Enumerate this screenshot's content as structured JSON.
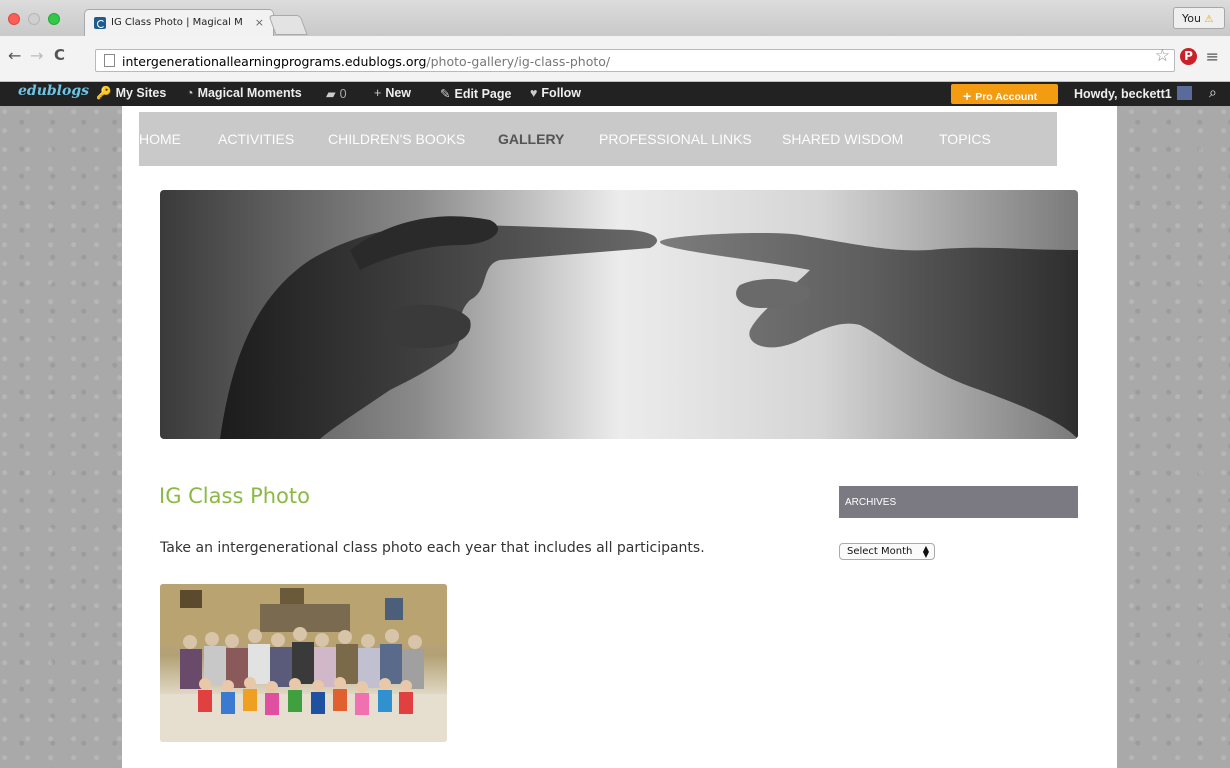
{
  "browser": {
    "tab_title": "IG Class Photo | Magical M",
    "tab_close": "×",
    "profile_label": "You",
    "profile_warn_icon": "⚠",
    "url_host": "intergenerationallearningprograms.edublogs.org",
    "url_path": "/photo-gallery/ig-class-photo/",
    "back_icon": "←",
    "forward_icon": "→",
    "reload_icon": "C",
    "star_icon": "☆",
    "pinterest_icon": "P",
    "menu_icon": "≡"
  },
  "adminbar": {
    "logo": "edublogs",
    "my_sites": "My Sites",
    "site_name": "Magical Moments",
    "comments_count": "0",
    "new_label": "New",
    "edit_page": "Edit Page",
    "follow": "Follow",
    "pro_account": "Pro Account",
    "howdy": "Howdy, beckett1",
    "key_icon": "🔑",
    "gauge_icon": "◔",
    "comment_icon": "▰",
    "plus_icon": "+",
    "pencil_icon": "✎",
    "heart_icon": "♥",
    "search_icon": "⌕",
    "accent_color": "#f39c11"
  },
  "nav": {
    "items": [
      "HOME",
      "ACTIVITIES",
      "CHILDREN'S BOOKS",
      "GALLERY",
      "PROFESSIONAL LINKS",
      "SHARED WISDOM",
      "TOPICS"
    ],
    "active": "GALLERY"
  },
  "post": {
    "title": "IG Class Photo",
    "body": "Take an intergenerational class photo each year that includes all participants.",
    "title_color": "#8aba43"
  },
  "sidebar": {
    "archives_title": "ARCHIVES",
    "archives_select": "Select Month"
  }
}
